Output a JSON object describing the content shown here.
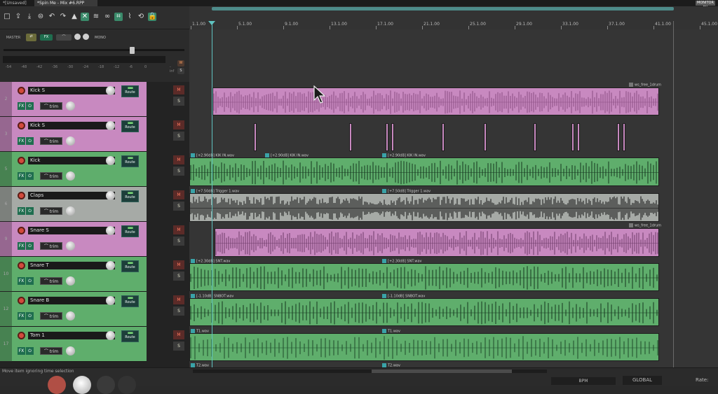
{
  "tabs": [
    {
      "label": "*[Unsaved]"
    },
    {
      "label": "*Spin Me - Mix #6.RPP"
    }
  ],
  "monitor_fx": "MONITOR FX",
  "toolbar": {
    "icons": [
      "new-project-icon",
      "open-project-icon",
      "save-project-icon",
      "project-settings-icon",
      "undo-icon",
      "redo-icon",
      "metronome-icon",
      "snap-icon",
      "ripple-icon",
      "link-icon",
      "grid-icon",
      "envelope-icon",
      "lock-icon",
      "loop-icon",
      "trim-behind-icon"
    ]
  },
  "master": {
    "label": "MASTER",
    "fx_label": "FX",
    "mono_label": "MONO",
    "scale": [
      "-inf",
      "-54",
      "-48",
      "-42",
      "-36",
      "-30",
      "-24",
      "-18",
      "-12",
      "-6",
      "0"
    ],
    "w_label": "W",
    "s_label": "S"
  },
  "tracks": [
    {
      "num": "2",
      "name": "Kick S",
      "color": "#c889c0"
    },
    {
      "num": "3",
      "name": "Kick S",
      "color": "#c889c0"
    },
    {
      "num": "5",
      "name": "Kick",
      "color": "#5fae6c"
    },
    {
      "num": "6",
      "name": "Claps",
      "color": "#a6aaa6"
    },
    {
      "num": "9",
      "name": "Snare S",
      "color": "#c889c0"
    },
    {
      "num": "10",
      "name": "Snare T",
      "color": "#5fae6c"
    },
    {
      "num": "12",
      "name": "Snare B",
      "color": "#5fae6c"
    },
    {
      "num": "17",
      "name": "Tom 1",
      "color": "#5fae6c"
    }
  ],
  "track_controls": {
    "route_label": "Route",
    "fx_label": "FX",
    "trim_label": "trim",
    "mute_label": "M",
    "solo_label": "S"
  },
  "ruler": {
    "labels": [
      "1.1.00",
      "5.1.00",
      "9.1.00",
      "13.1.00",
      "17.1.00",
      "21.1.00",
      "25.1.00",
      "29.1.00",
      "33.1.00",
      "37.1.00",
      "41.1.00",
      "45.1.00"
    ]
  },
  "items": {
    "kick_s_label": "ws_free_1drum",
    "kick_a": "[+2.90dB] KIK IN.wav",
    "kick_b": "[+2.90dB] KIK IN.wav",
    "kick_c": "[+2.90dB] KIK IN.wav",
    "claps_a": "[+7.50dB] Trigger 1.wav",
    "claps_b": "[+7.50dB] Trigger 1.wav",
    "snare_s_label": "ws_free_1drum",
    "snare_t_a": "[+2.30dB] SNT.wav",
    "snare_t_b": "[+2.30dB] SNT.wav",
    "snare_b_a": "[-1.10dB] SNBOT.wav",
    "snare_b_b": "[-1.10dB] SNBOT.wav",
    "tom1_a": "T1.wav",
    "tom1_b": "T1.wav",
    "tom2_a": "T2.wav",
    "tom2_b": "T2.wav"
  },
  "status": {
    "text": "Move item ignoring time selection",
    "bpm_label": "BPM",
    "global_label": "GLOBAL",
    "rate_label": "Rate:"
  }
}
